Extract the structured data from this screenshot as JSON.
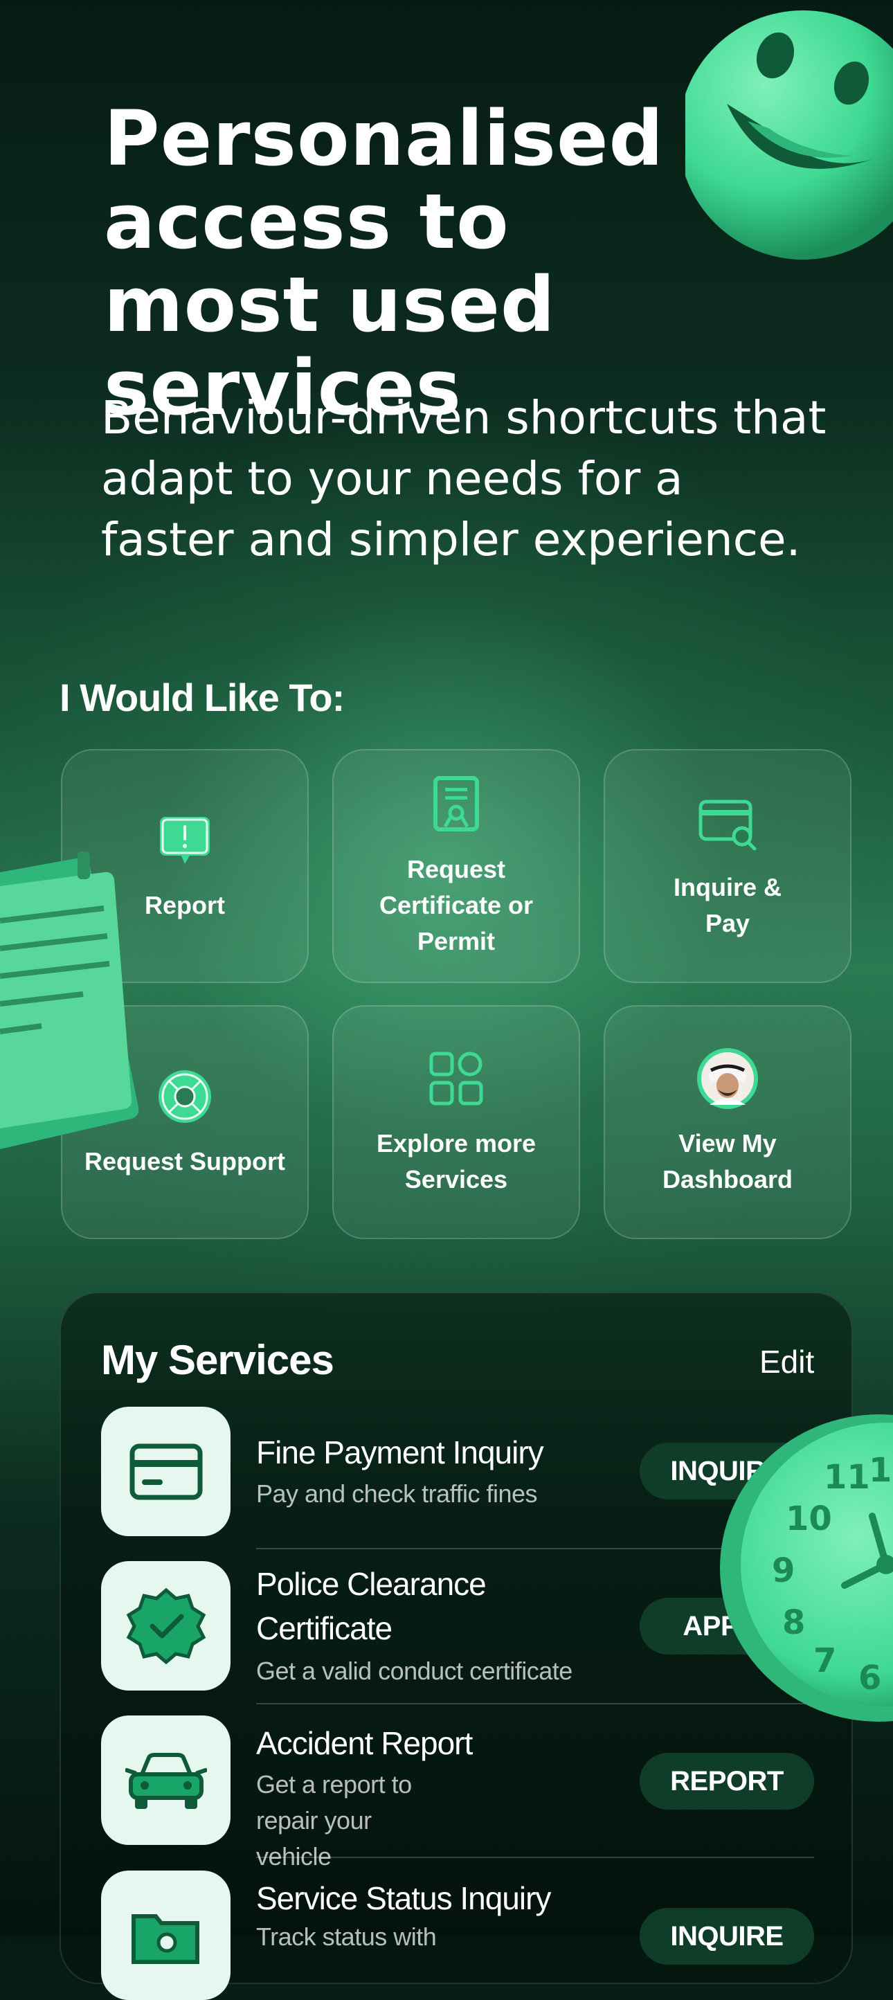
{
  "hero": {
    "title": "Personalised access to most used services",
    "subtitle": "Behaviour-driven shortcuts that adapt to your needs for a faster and simpler experience."
  },
  "quick_actions": {
    "label": "I Would Like To:",
    "items": [
      {
        "label": "Report",
        "icon": "report-icon"
      },
      {
        "label": "Request Certificate or Permit",
        "icon": "certificate-icon"
      },
      {
        "label": "Inquire & Pay",
        "icon": "inquire-pay-icon"
      },
      {
        "label": "Request Support",
        "icon": "lifebuoy-icon"
      },
      {
        "label": "Explore more Services",
        "icon": "grid-icon"
      },
      {
        "label": "View My Dashboard",
        "icon": "avatar"
      }
    ]
  },
  "my_services": {
    "title": "My Services",
    "edit_label": "Edit",
    "items": [
      {
        "title": "Fine Payment Inquiry",
        "desc": "Pay and check traffic fines",
        "button": "INQUIRE",
        "icon": "card-icon"
      },
      {
        "title": "Police Clearance Certificate",
        "desc": "Get a valid conduct certificate",
        "button": "APPLY",
        "icon": "badge-check-icon"
      },
      {
        "title": "Accident Report",
        "desc": "Get a report to repair your vehicle",
        "button": "REPORT",
        "icon": "car-icon"
      },
      {
        "title": "Service Status Inquiry",
        "desc": "Track status with",
        "button": "INQUIRE",
        "icon": "folder-search-icon"
      }
    ]
  },
  "colors": {
    "accent": "#3ed993",
    "button_bg": "#0f3d2a",
    "icon_bg": "#e6f7ef"
  }
}
